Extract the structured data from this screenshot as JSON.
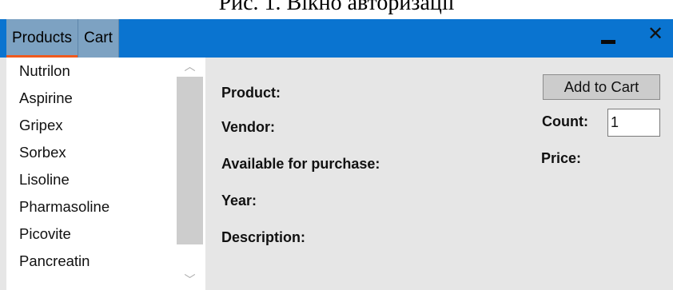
{
  "caption": {
    "text": "Рис. 1. Вікно авторизації"
  },
  "window": {
    "tabs": [
      {
        "label": "Products",
        "active": true
      },
      {
        "label": "Cart",
        "active": false
      }
    ],
    "controls": {
      "minimize_icon": "minimize-icon",
      "close_glyph": "✕"
    },
    "colors": {
      "titlebar": "#0a74d0",
      "tab_bg": "#7da2c2",
      "active_tab_underline": "#f05a1e",
      "panel_bg": "#e6e6e6"
    }
  },
  "product_list": {
    "items": [
      "Nutrilon",
      "Aspirine",
      "Gripex",
      "Sorbex",
      "Lisoline",
      "Pharmasoline",
      "Picovite",
      "Pancreatin"
    ],
    "scroll_up_glyph": "︿",
    "scroll_down_glyph": "﹀"
  },
  "details": {
    "product_label": "Product:",
    "vendor_label": "Vendor:",
    "available_label": "Available for purchase:",
    "year_label": "Year:",
    "description_label": "Description:",
    "add_to_cart_label": "Add to Cart",
    "count_label": "Count:",
    "count_value": "1",
    "price_label": "Price:"
  }
}
